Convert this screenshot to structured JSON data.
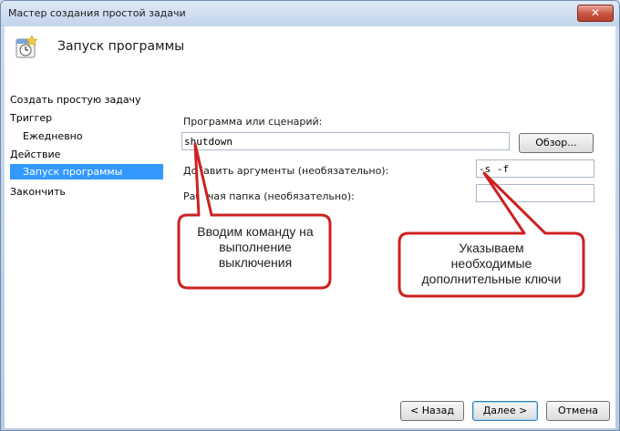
{
  "window": {
    "title": "Мастер создания простой задачи",
    "close_label": "✕"
  },
  "header": {
    "title": "Запуск программы",
    "icon": "task-clock-icon"
  },
  "nav": {
    "items": [
      {
        "label": "Создать простую задачу",
        "selected": false
      },
      {
        "label": "Триггер",
        "selected": false
      },
      {
        "label": "Ежедневно",
        "selected": false
      },
      {
        "label": "Действие",
        "selected": false
      },
      {
        "label": "Запуск программы",
        "selected": true
      },
      {
        "label": "Закончить",
        "selected": false
      }
    ]
  },
  "form": {
    "program_label": "Программа или сценарий:",
    "program_value": "shutdown",
    "browse_label": "Обзор...",
    "args_label": "Добавить аргументы (необязательно):",
    "args_value": "-s -f",
    "workdir_label": "Рабочая папка (необязательно):",
    "workdir_value": ""
  },
  "callouts": {
    "left": [
      "Вводим команду на",
      "выполнение",
      "выключения"
    ],
    "right": [
      "Указываем",
      "необходимые",
      "дополнительные ключи"
    ],
    "color": "#cc2222"
  },
  "footer": {
    "back_label": "< Назад",
    "next_label": "Далее >",
    "cancel_label": "Отмена"
  }
}
